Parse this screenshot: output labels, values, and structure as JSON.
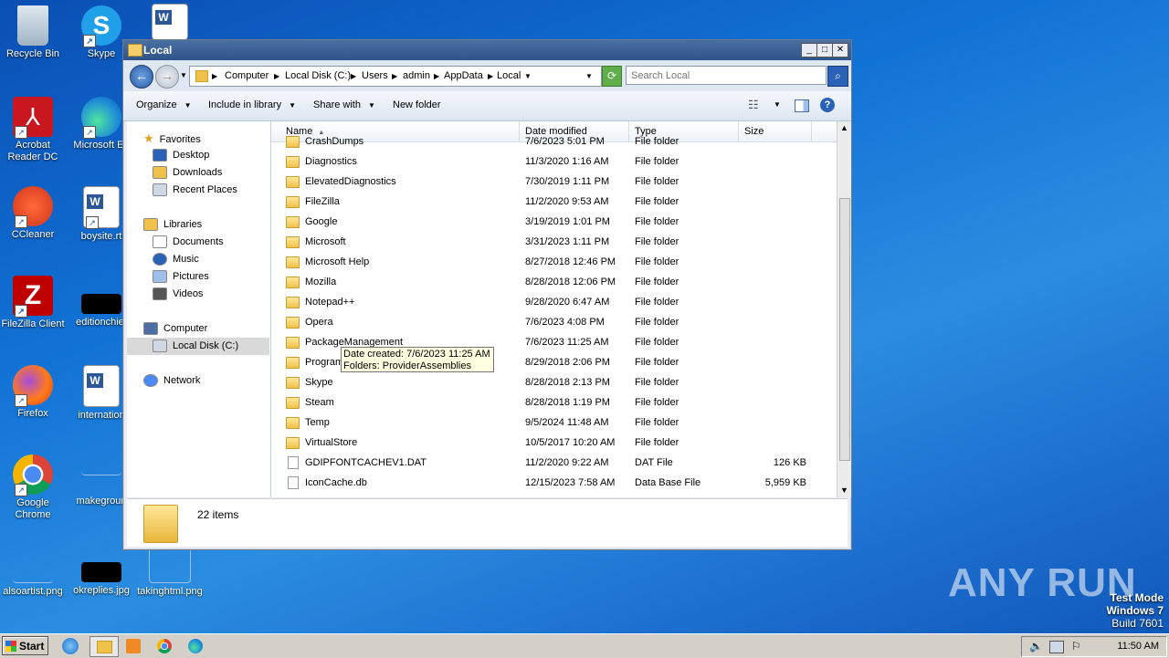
{
  "desktop": {
    "icons": [
      {
        "label": "Recycle Bin",
        "icon": "recycle-bin-icon"
      },
      {
        "label": "Skype",
        "icon": "skype-icon"
      },
      {
        "label": "Acrobat Reader DC",
        "icon": "acrobat-icon"
      },
      {
        "label": "Microsoft Ed",
        "icon": "edge-icon"
      },
      {
        "label": "CCleaner",
        "icon": "ccleaner-icon"
      },
      {
        "label": "boysite.rt",
        "icon": "word-doc-icon"
      },
      {
        "label": "FileZilla Client",
        "icon": "filezilla-icon"
      },
      {
        "label": "editionchief",
        "icon": "image-thumb-icon"
      },
      {
        "label": "Firefox",
        "icon": "firefox-icon"
      },
      {
        "label": "internation",
        "icon": "word-doc-icon"
      },
      {
        "label": "Google Chrome",
        "icon": "chrome-icon"
      },
      {
        "label": "makegroun",
        "icon": "image-thumb-icon"
      },
      {
        "label": "alsoartist.png",
        "icon": "image-thumb-icon"
      },
      {
        "label": "okreplies.jpg",
        "icon": "image-thumb-icon"
      },
      {
        "label": "takinghtml.png",
        "icon": "image-thumb-icon"
      }
    ]
  },
  "window": {
    "title": "Local",
    "controls": {
      "minimize": "_",
      "maximize": "□",
      "close": "✕"
    },
    "address": {
      "crumbs": [
        "Computer",
        "Local Disk (C:)",
        "Users",
        "admin",
        "AppData",
        "Local"
      ],
      "search_placeholder": "Search Local"
    },
    "toolbar": {
      "organize": "Organize",
      "include": "Include in library",
      "share": "Share with",
      "new_folder": "New folder"
    },
    "nav": {
      "favorites": "Favorites",
      "desktop": "Desktop",
      "downloads": "Downloads",
      "recent": "Recent Places",
      "libraries": "Libraries",
      "documents": "Documents",
      "music": "Music",
      "pictures": "Pictures",
      "videos": "Videos",
      "computer": "Computer",
      "localdisk": "Local Disk (C:)",
      "network": "Network"
    },
    "columns": {
      "name": "Name",
      "date": "Date modified",
      "type": "Type",
      "size": "Size"
    },
    "rows": [
      {
        "name": "CrashDumps",
        "date": "7/6/2023 5:01 PM",
        "type": "File folder",
        "size": "",
        "kind": "folder"
      },
      {
        "name": "Diagnostics",
        "date": "11/3/2020 1:16 AM",
        "type": "File folder",
        "size": "",
        "kind": "folder"
      },
      {
        "name": "ElevatedDiagnostics",
        "date": "7/30/2019 1:11 PM",
        "type": "File folder",
        "size": "",
        "kind": "folder"
      },
      {
        "name": "FileZilla",
        "date": "11/2/2020 9:53 AM",
        "type": "File folder",
        "size": "",
        "kind": "folder"
      },
      {
        "name": "Google",
        "date": "3/19/2019 1:01 PM",
        "type": "File folder",
        "size": "",
        "kind": "folder"
      },
      {
        "name": "Microsoft",
        "date": "3/31/2023 1:11 PM",
        "type": "File folder",
        "size": "",
        "kind": "folder"
      },
      {
        "name": "Microsoft Help",
        "date": "8/27/2018 12:46 PM",
        "type": "File folder",
        "size": "",
        "kind": "folder"
      },
      {
        "name": "Mozilla",
        "date": "8/28/2018 12:06 PM",
        "type": "File folder",
        "size": "",
        "kind": "folder"
      },
      {
        "name": "Notepad++",
        "date": "9/28/2020 6:47 AM",
        "type": "File folder",
        "size": "",
        "kind": "folder"
      },
      {
        "name": "Opera",
        "date": "7/6/2023 4:08 PM",
        "type": "File folder",
        "size": "",
        "kind": "folder"
      },
      {
        "name": "PackageManagement",
        "date": "7/6/2023 11:25 AM",
        "type": "File folder",
        "size": "",
        "kind": "folder"
      },
      {
        "name": "Programs",
        "date": "8/29/2018 2:06 PM",
        "type": "File folder",
        "size": "",
        "kind": "folder"
      },
      {
        "name": "Skype",
        "date": "8/28/2018 2:13 PM",
        "type": "File folder",
        "size": "",
        "kind": "folder"
      },
      {
        "name": "Steam",
        "date": "8/28/2018 1:19 PM",
        "type": "File folder",
        "size": "",
        "kind": "folder"
      },
      {
        "name": "Temp",
        "date": "9/5/2024 11:48 AM",
        "type": "File folder",
        "size": "",
        "kind": "folder"
      },
      {
        "name": "VirtualStore",
        "date": "10/5/2017 10:20 AM",
        "type": "File folder",
        "size": "",
        "kind": "folder"
      },
      {
        "name": "GDIPFONTCACHEV1.DAT",
        "date": "11/2/2020 9:22 AM",
        "type": "DAT File",
        "size": "126 KB",
        "kind": "file"
      },
      {
        "name": "IconCache.db",
        "date": "12/15/2023 7:58 AM",
        "type": "Data Base File",
        "size": "5,959 KB",
        "kind": "file"
      }
    ],
    "tooltip": {
      "line1": "Date created: 7/6/2023 11:25 AM",
      "line2": "Folders: ProviderAssemblies"
    },
    "status": {
      "count": "22 items"
    }
  },
  "watermark": {
    "brand": "ANY RUN",
    "line1": "Test Mode",
    "line2": "Windows 7",
    "line3": "Build 7601"
  },
  "taskbar": {
    "start": "Start",
    "clock": "11:50 AM"
  }
}
